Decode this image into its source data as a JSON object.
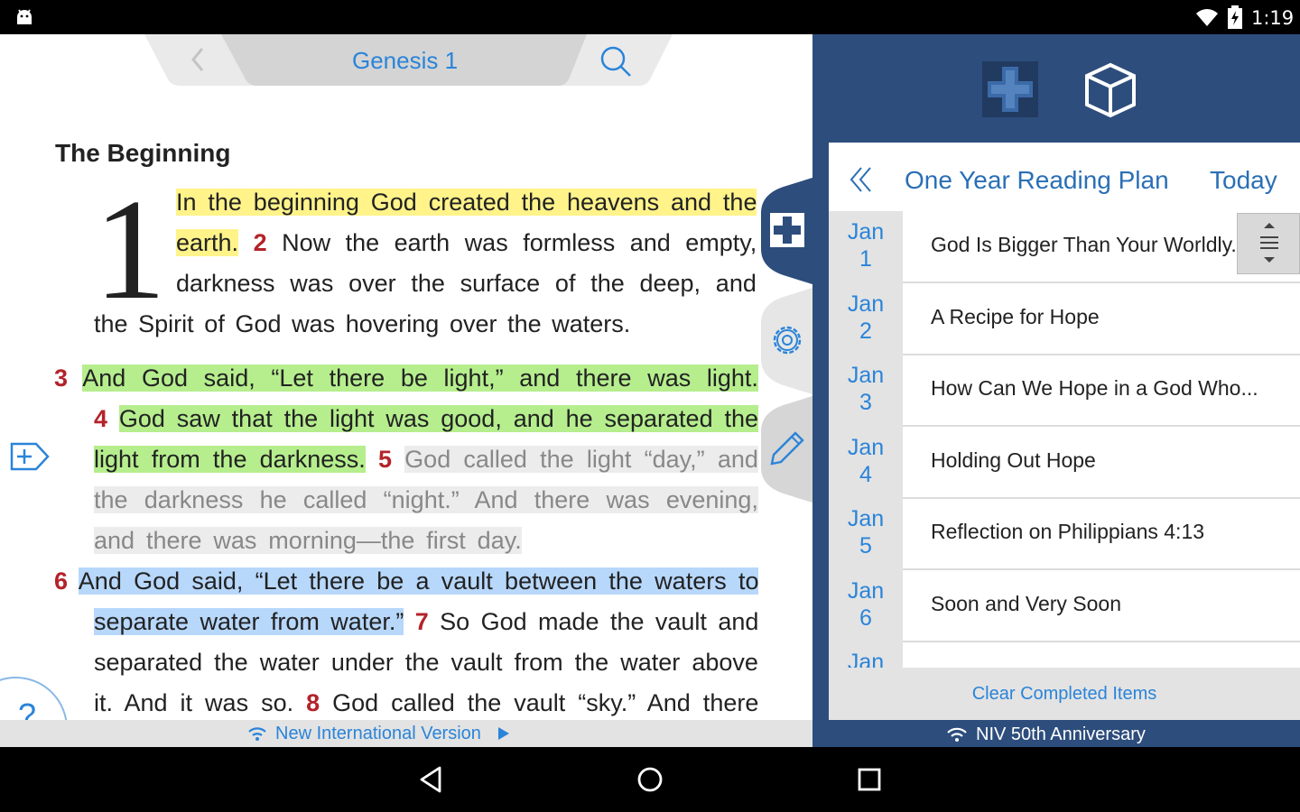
{
  "status_bar": {
    "time": "1:19"
  },
  "bible": {
    "chapter_title": "Genesis 1",
    "section_title": "The Beginning",
    "chapter_number": "1",
    "lines": [
      {
        "segments": [
          {
            "text": "In the beginning God created the heavens and the",
            "style": "hl-y"
          }
        ]
      },
      {
        "segments": [
          {
            "text": "earth.",
            "style": "hl-y"
          },
          {
            "text": " "
          },
          {
            "text": "2",
            "style": "vn"
          },
          {
            "text": " Now the earth was formless and empty,"
          }
        ]
      },
      {
        "segments": [
          {
            "text": "darkness was over the surface of the deep, and"
          }
        ]
      },
      {
        "segments": [
          {
            "text": "the Spirit of God was hovering over the waters."
          }
        ]
      },
      {
        "segments": [
          {
            "text": "3",
            "style": "vn"
          },
          {
            "text": " "
          },
          {
            "text": "And God said, “Let there be light,” and there was light.",
            "style": "hl-g"
          }
        ]
      },
      {
        "segments": [
          {
            "text": "4",
            "style": "vn"
          },
          {
            "text": " "
          },
          {
            "text": "God saw that the light was good, and he separated the",
            "style": "hl-g"
          }
        ]
      },
      {
        "segments": [
          {
            "text": "light from the darkness.",
            "style": "hl-g"
          },
          {
            "text": " "
          },
          {
            "text": "5",
            "style": "vn"
          },
          {
            "text": " "
          },
          {
            "text": "God called the light “day,” and",
            "style": "hl-gray"
          }
        ]
      },
      {
        "segments": [
          {
            "text": "the darkness he called “night.” And there was evening,",
            "style": "hl-gray"
          }
        ]
      },
      {
        "segments": [
          {
            "text": "and there was morning—the first day.",
            "style": "hl-gray"
          }
        ]
      },
      {
        "segments": [
          {
            "text": "6",
            "style": "vn"
          },
          {
            "text": " "
          },
          {
            "text": "And God said, “Let there be a vault between the waters to",
            "style": "hl-b"
          }
        ]
      },
      {
        "segments": [
          {
            "text": "separate water from water.”",
            "style": "hl-b"
          },
          {
            "text": " "
          },
          {
            "text": "7",
            "style": "vn"
          },
          {
            "text": " So God made the vault and"
          }
        ]
      },
      {
        "segments": [
          {
            "text": "separated the water under the vault from the water above"
          }
        ]
      },
      {
        "segments": [
          {
            "text": "it. And it was so. "
          },
          {
            "text": "8",
            "style": "vn"
          },
          {
            "text": " God called the vault “sky.” And there"
          }
        ]
      }
    ],
    "help_label": "?",
    "version_label": "New International Version"
  },
  "reading_plan": {
    "title": "One Year Reading Plan",
    "today_label": "Today",
    "items": [
      {
        "month": "Jan",
        "day": "1",
        "title": "God Is Bigger Than Your Worldly..."
      },
      {
        "month": "Jan",
        "day": "2",
        "title": "A Recipe for Hope"
      },
      {
        "month": "Jan",
        "day": "3",
        "title": "How Can We Hope in a God Who..."
      },
      {
        "month": "Jan",
        "day": "4",
        "title": "Holding Out Hope"
      },
      {
        "month": "Jan",
        "day": "5",
        "title": "Reflection on Philippians 4:13"
      },
      {
        "month": "Jan",
        "day": "6",
        "title": "Soon and Very Soon"
      },
      {
        "month": "Jan",
        "day": "",
        "title": ""
      }
    ],
    "clear_label": "Clear Completed Items",
    "footer_label": "NIV 50th Anniversary"
  },
  "colors": {
    "accent": "#2a84d9",
    "verse_number": "#b3232a",
    "panel_blue": "#2d4d7c",
    "highlight_yellow": "#fff38a",
    "highlight_green": "#b6ee8e",
    "highlight_blue": "#b7d7fb"
  },
  "icons": {
    "status": [
      "android-icon",
      "wifi-icon",
      "battery-icon"
    ],
    "bible_nav": [
      "back-chevron-icon",
      "search-icon"
    ],
    "side_tabs": [
      "cross-logo-icon",
      "gear-icon",
      "pencil-icon"
    ],
    "right_header": [
      "cross-logo-icon",
      "cube-icon"
    ],
    "system_nav": [
      "back-triangle-icon",
      "home-circle-icon",
      "recents-square-icon"
    ]
  }
}
